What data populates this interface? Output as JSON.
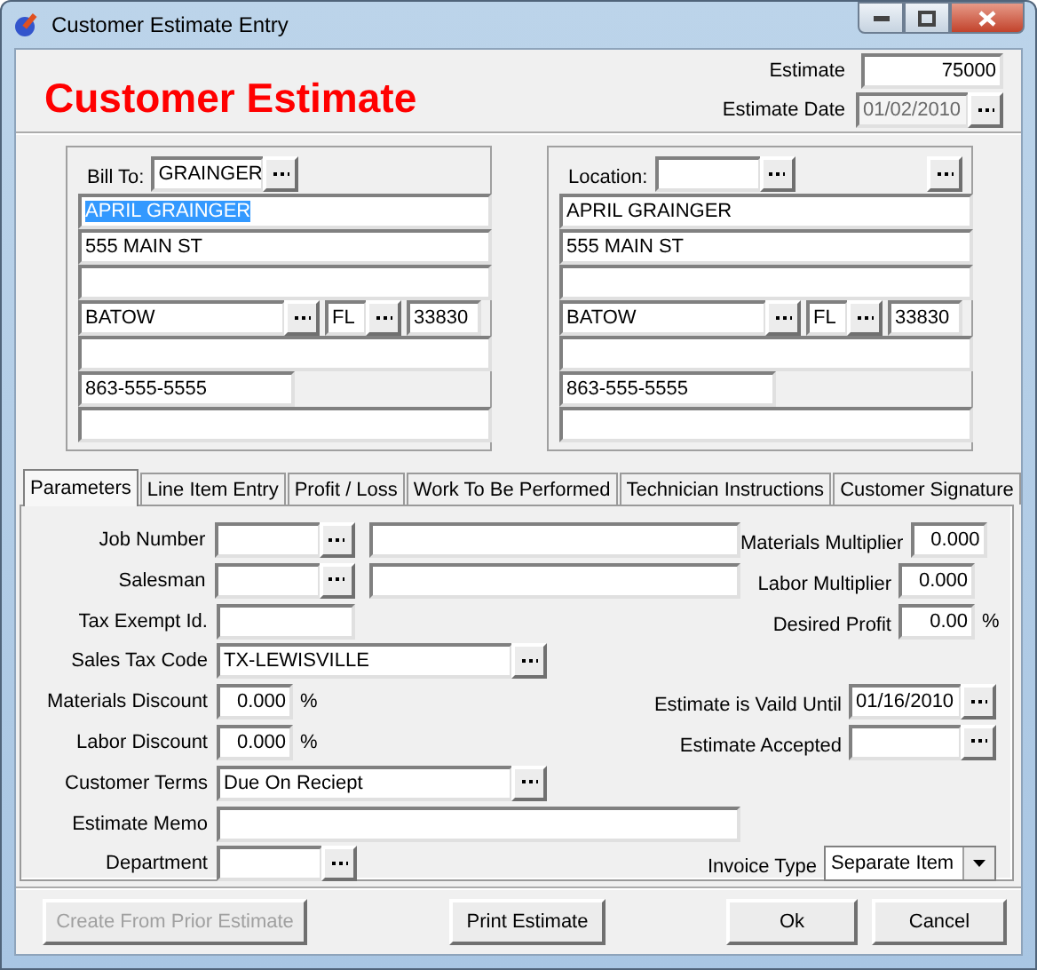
{
  "window": {
    "title": "Customer Estimate Entry"
  },
  "header": {
    "title": "Customer Estimate",
    "estimate": {
      "label": "Estimate",
      "value": "75000"
    },
    "estimate_date": {
      "label": "Estimate Date",
      "value": "01/02/2010",
      "disabled": true
    }
  },
  "bill_to": {
    "label": "Bill To:",
    "code": "GRAINGER",
    "name": "APRIL GRAINGER",
    "name_selected": true,
    "street": "555 MAIN ST",
    "city": "BATOW",
    "state": "FL",
    "zip": "33830",
    "phone": "863-555-5555"
  },
  "location": {
    "label": "Location:",
    "name": "APRIL GRAINGER",
    "name_selected": false,
    "street": "555 MAIN ST",
    "city": "BATOW",
    "state": "FL",
    "zip": "33830",
    "phone": "863-555-5555"
  },
  "tabs": [
    {
      "label": "Parameters",
      "selected": true
    },
    {
      "label": "Line Item Entry",
      "selected": false
    },
    {
      "label": "Profit / Loss",
      "selected": false
    },
    {
      "label": "Work To Be Performed",
      "selected": false
    },
    {
      "label": "Technician Instructions",
      "selected": false
    },
    {
      "label": "Customer Signature",
      "selected": false
    }
  ],
  "parameters": [
    {
      "left": {
        "kind": "code_desc",
        "label": "Job Number"
      },
      "right": {
        "kind": "number",
        "label": "Materials Multiplier",
        "value": "0.000"
      }
    },
    {
      "left": {
        "kind": "code_desc",
        "label": "Salesman"
      },
      "right": {
        "kind": "number",
        "label": "Labor Multiplier",
        "value": "0.000"
      }
    },
    {
      "left": {
        "kind": "short",
        "label": "Tax Exempt Id."
      },
      "right": {
        "kind": "number",
        "label": "Desired Profit",
        "value": "0.00",
        "unit": "%"
      }
    },
    {
      "left": {
        "kind": "lookup",
        "label": "Sales Tax Code",
        "value": "TX-LEWISVILLE"
      }
    },
    {
      "left": {
        "kind": "percent",
        "label": "Materials Discount",
        "value": "0.000",
        "unit": "%"
      },
      "right": {
        "kind": "date",
        "label": "Estimate is Vaild Until",
        "value": "01/16/2010"
      }
    },
    {
      "left": {
        "kind": "percent",
        "label": "Labor Discount",
        "value": "0.000",
        "unit": "%"
      },
      "right": {
        "kind": "date",
        "label": "Estimate Accepted"
      }
    },
    {
      "left": {
        "kind": "lookup",
        "label": "Customer Terms",
        "value": "Due On Reciept"
      }
    },
    {
      "left": {
        "kind": "memo",
        "label": "Estimate Memo"
      }
    },
    {
      "left": {
        "kind": "code",
        "label": "Department"
      },
      "right": {
        "kind": "select",
        "label": "Invoice Type",
        "value": "Separate Item"
      }
    }
  ],
  "buttons": [
    {
      "label": "Create From Prior Estimate",
      "disabled": true
    },
    {
      "label": "Print Estimate",
      "disabled": false
    },
    {
      "label": "Ok",
      "disabled": false
    },
    {
      "label": "Cancel",
      "disabled": false
    }
  ]
}
